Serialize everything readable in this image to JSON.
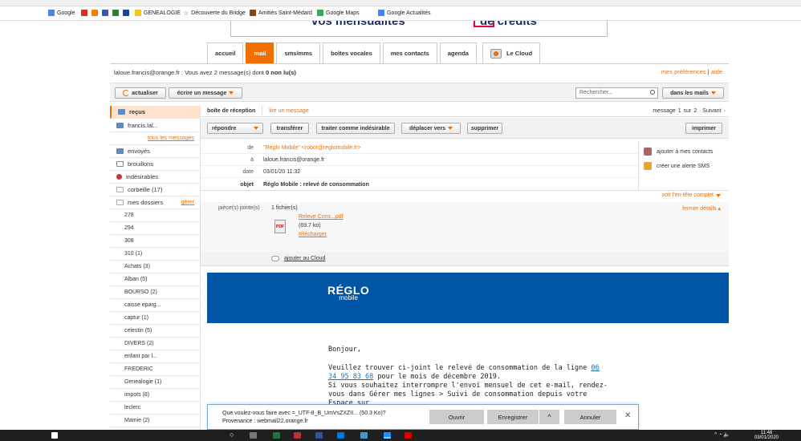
{
  "bookmarks": [
    {
      "label": "Google",
      "icon": "google-icon",
      "color": "#4285f4"
    },
    {
      "label": "GENEALOGIE",
      "icon": "folder-icon",
      "color": "#f5c518"
    },
    {
      "label": "Découverte du Bridge",
      "icon": "star-icon",
      "color": "#666666"
    },
    {
      "label": "Amitiés Saint-Médard",
      "icon": "person-icon",
      "color": "#8b4513"
    },
    {
      "label": "Google Maps",
      "icon": "maps-icon",
      "color": "#34a853"
    },
    {
      "label": "Google Actualités",
      "icon": "news-icon",
      "color": "#4285f4"
    }
  ],
  "banner": {
    "text_left": "vos mensualités",
    "text_right": "de crédits"
  },
  "tabs": [
    {
      "label": "accueil",
      "active": false
    },
    {
      "label": "mail",
      "active": true
    },
    {
      "label": "sms/mms",
      "active": false
    },
    {
      "label": "boîtes vocales",
      "active": false
    },
    {
      "label": "mes contacts",
      "active": false
    },
    {
      "label": "agenda",
      "active": false
    }
  ],
  "cloud_tab": "Le Cloud",
  "info": {
    "text": "laloue.francis@orange.fr : Vous avez 2 message(s) dont",
    "unread": "0 non lu(s)",
    "prefs": "mes préférences",
    "sep": "|",
    "help": "aide"
  },
  "toolbar": {
    "refresh": "actualiser",
    "compose": "écrire un message",
    "search_placeholder": "Rechercher...",
    "search_scope": "dans les mails"
  },
  "sidebar": {
    "items": [
      {
        "label": "reçus",
        "color": "#5b8bc9"
      },
      {
        "label": "francis.lal...",
        "color": "#5b8bc9"
      },
      {
        "label": "tous les messages",
        "color": ""
      },
      {
        "label": "envoyés",
        "color": "#5b8bc9"
      },
      {
        "label": "brouillons",
        "color": "#888888"
      },
      {
        "label": "indésirables",
        "color": "#cc3333"
      },
      {
        "label": "corbeille (17)",
        "color": "#bbbbbb"
      },
      {
        "label": "mes dossiers",
        "color": "#bbbbbb"
      }
    ],
    "manage": "gérer",
    "folders": [
      "278",
      "294",
      "308",
      "310 (1)",
      "Achats (3)",
      "Alban (5)",
      "BOURSO (2)",
      "caisse eparg...",
      "captur (1)",
      "celestin (5)",
      "DIVERS (2)",
      "enfant par l...",
      "FREDERIC",
      "Genealogie (1)",
      "impots (8)",
      "leclerc",
      "Mamie (2)"
    ]
  },
  "crumb": {
    "inbox": "boîte de réception",
    "current": "lire un message",
    "pager_label": "message",
    "pager_current": "1",
    "pager_sep": "sur",
    "pager_total": "2",
    "next": "Suivant"
  },
  "actions": {
    "reply": "répondre",
    "forward": "transférer",
    "spam": "traiter comme indésirable",
    "move": "déplacer vers",
    "delete": "supprimer",
    "print": "imprimer"
  },
  "headers": {
    "from_label": "de",
    "from_value": "\"Réglo Mobile\" <robot@reglomobile.fr>",
    "to_label": "à",
    "to_value": "laloue.francis@orange.fr",
    "date_label": "date",
    "date_value": "03/01/20 11:32",
    "subject_label": "objet",
    "subject_value": "Réglo Mobile : relevé de consommation",
    "add_contact": "ajouter à mes contacts",
    "sms_alert": "créer une alerte SMS",
    "full_header": "voir l'en-tête complet"
  },
  "attachment": {
    "label": "pièce(s) jointe(s)",
    "count": "1 fichier(s)",
    "close_details": "fermer détails",
    "filename": "Releve Cons...pdf",
    "size": "(69.7 ko)",
    "download": "télécharger",
    "pdf_icon": "PDF",
    "cloud": "ajouter au Cloud"
  },
  "logo": {
    "main": "RÉGLO",
    "sub": "mobile"
  },
  "email": {
    "greeting": "Bonjour,",
    "line1": "Veuillez trouver ci-joint le relevé de consommation de la ligne",
    "phone": "06 34 95 83 68",
    "line1b": "pour le mois de décembre 2019.",
    "line2": "Si vous souhaitez interrompre l'envoi mensuel de cet e-mail, rendez-vous dans Gérer mes lignes > Suivi de consommation depuis votre Espace sur"
  },
  "download_bar": {
    "question": "Que voulez-vous faire avec =_UTF-8_B_UmVsZXZII... (50.3 Ko)?",
    "origin": "Provenance : webmail22.orange.fr",
    "open": "Ouvrir",
    "save": "Enregistrer",
    "cancel": "Annuler"
  },
  "taskbar": {
    "time": "11:48",
    "date": "03/01/2020"
  }
}
